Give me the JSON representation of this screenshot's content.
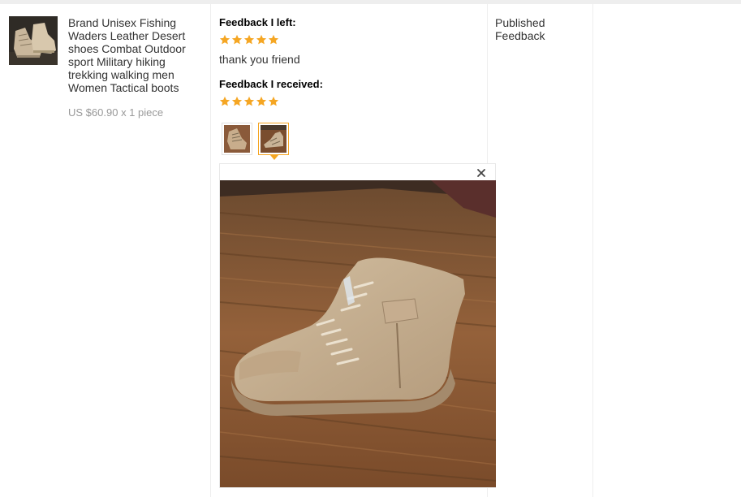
{
  "product": {
    "title": "Brand Unisex Fishing Waders Leather Desert shoes Combat Outdoor sport Military hiking trekking walking men Women Tactical boots",
    "price": "US $60.90",
    "quantity": "x 1 piece",
    "thumbnail_icon": "boot-product-photo"
  },
  "feedback": {
    "left_heading": "Feedback I left:",
    "left_rating": 5,
    "left_comment": "thank you friend",
    "received_heading": "Feedback I received:",
    "received_rating": 5,
    "star_color": "#f5a623",
    "photos": [
      {
        "name": "buyer-photo-1",
        "selected": false
      },
      {
        "name": "buyer-photo-2",
        "selected": true
      }
    ],
    "preview_close_icon": "close-icon"
  },
  "status": {
    "label": "Published Feedback"
  }
}
